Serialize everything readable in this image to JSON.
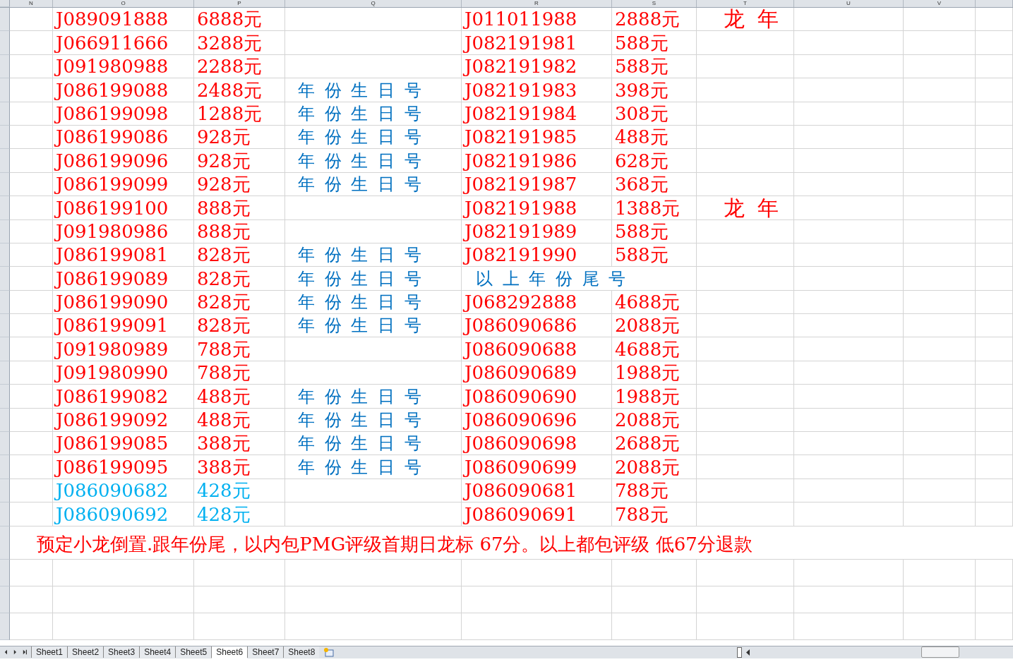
{
  "columns": [
    "N",
    "O",
    "P",
    "Q",
    "R",
    "S",
    "T",
    "U",
    "V"
  ],
  "rows": [
    {
      "code": "J089091888",
      "price": "6888元",
      "color": "#ff0000",
      "code2": "J011011988",
      "price2": "2888元",
      "tag": "龙 年"
    },
    {
      "code": "J066911666",
      "price": "3288元",
      "color": "#ff0000",
      "code2": "J082191981",
      "price2": "588元"
    },
    {
      "code": "J091980988",
      "price": "2288元",
      "color": "#ff0000",
      "code2": "J082191982",
      "price2": "588元"
    },
    {
      "code": "J086199088",
      "price": "2488元",
      "color": "#ff0000",
      "note": "年 份 生 日 号",
      "code2": "J082191983",
      "price2": "398元"
    },
    {
      "code": "J086199098",
      "price": "1288元",
      "color": "#ff0000",
      "note": "年 份 生 日 号",
      "code2": "J082191984",
      "price2": "308元"
    },
    {
      "code": "J086199086",
      "price": "928元",
      "color": "#ff0000",
      "note": "年 份 生 日 号",
      "code2": "J082191985",
      "price2": "488元"
    },
    {
      "code": "J086199096",
      "price": "928元",
      "color": "#ff0000",
      "note": "年 份 生 日 号",
      "code2": "J082191986",
      "price2": "628元"
    },
    {
      "code": "J086199099",
      "price": "928元",
      "color": "#ff0000",
      "note": "年 份 生 日 号",
      "code2": "J082191987",
      "price2": "368元"
    },
    {
      "code": "J086199100",
      "price": "888元",
      "color": "#ff0000",
      "code2": "J082191988",
      "price2": "1388元",
      "tag": "龙 年"
    },
    {
      "code": "J091980986",
      "price": "888元",
      "color": "#ff0000",
      "code2": "J082191989",
      "price2": "588元"
    },
    {
      "code": "J086199081",
      "price": "828元",
      "color": "#ff0000",
      "note": "年 份 生 日 号",
      "code2": "J082191990",
      "price2": "588元"
    },
    {
      "code": "J086199089",
      "price": "828元",
      "color": "#ff0000",
      "note": "年 份 生 日 号",
      "note2": "以 上 年 份 尾 号"
    },
    {
      "code": "J086199090",
      "price": "828元",
      "color": "#ff0000",
      "note": "年 份 生 日 号",
      "code2": "J068292888",
      "price2": "4688元"
    },
    {
      "code": "J086199091",
      "price": "828元",
      "color": "#ff0000",
      "note": "年 份 生 日 号",
      "code2": "J086090686",
      "price2": "2088元"
    },
    {
      "code": "J091980989",
      "price": "788元",
      "color": "#ff0000",
      "code2": "J086090688",
      "price2": "4688元"
    },
    {
      "code": "J091980990",
      "price": "788元",
      "color": "#ff0000",
      "code2": "J086090689",
      "price2": "1988元"
    },
    {
      "code": "J086199082",
      "price": "488元",
      "color": "#ff0000",
      "note": "年 份 生 日 号",
      "code2": "J086090690",
      "price2": "1988元"
    },
    {
      "code": "J086199092",
      "price": "488元",
      "color": "#ff0000",
      "note": "年 份 生 日 号",
      "code2": "J086090696",
      "price2": "2088元"
    },
    {
      "code": "J086199085",
      "price": "388元",
      "color": "#ff0000",
      "note": "年 份 生 日 号",
      "code2": "J086090698",
      "price2": "2688元"
    },
    {
      "code": "J086199095",
      "price": "388元",
      "color": "#ff0000",
      "note": "年 份 生 日 号",
      "code2": "J086090699",
      "price2": "2088元"
    },
    {
      "code": "J086090682",
      "price": "428元",
      "color": "#00b0f0",
      "code2": "J086090681",
      "price2": "788元"
    },
    {
      "code": "J086090692",
      "price": "428元",
      "color": "#00b0f0",
      "code2": "J086090691",
      "price2": "788元"
    }
  ],
  "remark": "预定小龙倒置.跟年份尾，以内包PMG评级首期日龙标 67分。以上都包评级 低67分退款",
  "sheet_tabs": [
    {
      "label": "Sheet1",
      "selected": false
    },
    {
      "label": "Sheet2",
      "selected": false
    },
    {
      "label": "Sheet3",
      "selected": false
    },
    {
      "label": "Sheet4",
      "selected": false
    },
    {
      "label": "Sheet5",
      "selected": false
    },
    {
      "label": "Sheet6",
      "selected": true
    },
    {
      "label": "Sheet7",
      "selected": false
    },
    {
      "label": "Sheet8",
      "selected": false
    }
  ]
}
